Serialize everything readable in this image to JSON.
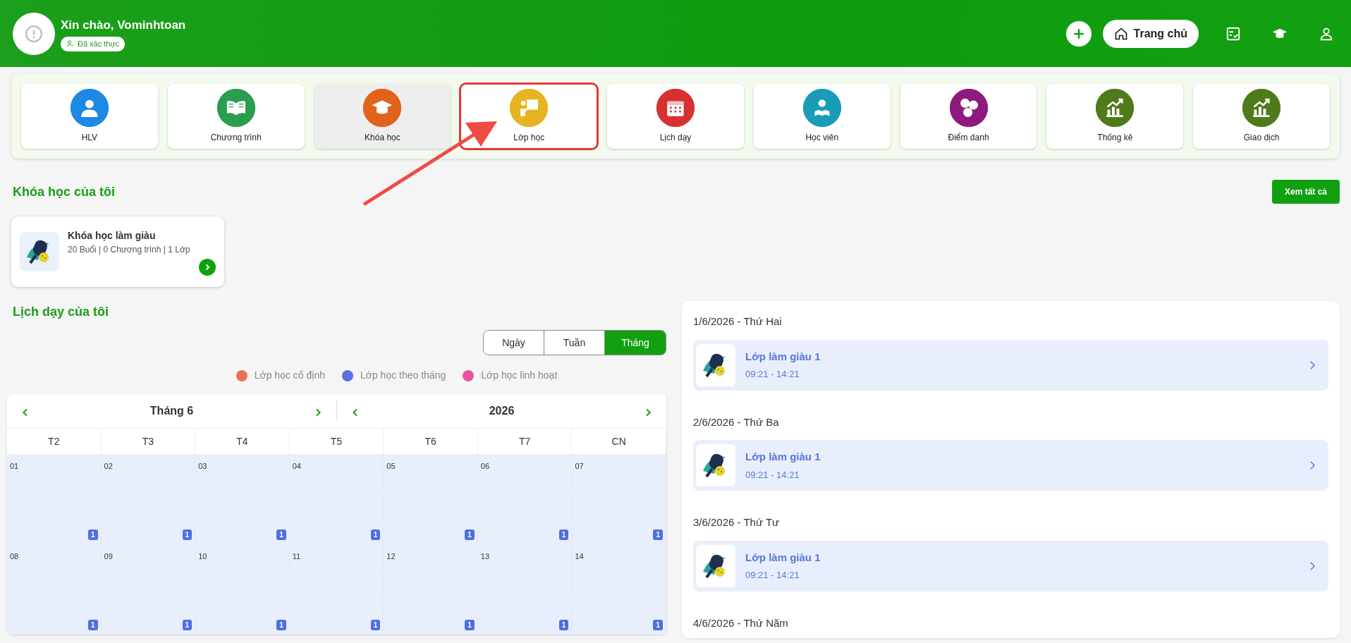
{
  "header": {
    "greeting": "Xin chào, Vominhtoan",
    "verified_badge": "Đã xác thực",
    "home_button": "Trang chủ"
  },
  "tiles": [
    {
      "label": "HLV",
      "kind": "person",
      "color": "#1e88e5",
      "selected": false,
      "highlighted": false
    },
    {
      "label": "Chương trình",
      "kind": "book",
      "color": "#2a9d4e",
      "selected": false,
      "highlighted": false
    },
    {
      "label": "Khóa học",
      "kind": "cap",
      "color": "#e0621b",
      "selected": true,
      "highlighted": false
    },
    {
      "label": "Lớp học",
      "kind": "teacher",
      "color": "#e6b422",
      "selected": false,
      "highlighted": true
    },
    {
      "label": "Lịch dạy",
      "kind": "calendar",
      "color": "#d63031",
      "selected": false,
      "highlighted": false
    },
    {
      "label": "Học viên",
      "kind": "reader",
      "color": "#1a9bb8",
      "selected": false,
      "highlighted": false
    },
    {
      "label": "Điểm danh",
      "kind": "numbers",
      "color": "#8e1a7e",
      "selected": false,
      "highlighted": false
    },
    {
      "label": "Thống kê",
      "kind": "chart",
      "color": "#4f7a1a",
      "selected": false,
      "highlighted": false
    },
    {
      "label": "Giao dịch",
      "kind": "chart",
      "color": "#4f7a1a",
      "selected": false,
      "highlighted": false
    }
  ],
  "my_courses": {
    "title": "Khóa học của tôi",
    "view_all": "Xem tất cả",
    "courses": [
      {
        "name": "Khóa học làm giàu",
        "meta": "20 Buổi | 0 Chương trình | 1 Lớp"
      }
    ]
  },
  "schedule": {
    "title": "Lịch dạy của tôi",
    "views": [
      {
        "label": "Ngày",
        "selected": false
      },
      {
        "label": "Tuần",
        "selected": false
      },
      {
        "label": "Tháng",
        "selected": true
      }
    ],
    "legend": [
      {
        "label": "Lớp học cố định",
        "color": "#e8705a"
      },
      {
        "label": "Lớp học theo tháng",
        "color": "#5a6fe0"
      },
      {
        "label": "Lớp học linh hoạt",
        "color": "#e8559e"
      }
    ],
    "month": "Tháng 6",
    "year": "2026",
    "weekdays": [
      "T2",
      "T3",
      "T4",
      "T5",
      "T6",
      "T7",
      "CN"
    ],
    "days": [
      {
        "day": "01",
        "count": "1"
      },
      {
        "day": "02",
        "count": "1"
      },
      {
        "day": "03",
        "count": "1"
      },
      {
        "day": "04",
        "count": "1"
      },
      {
        "day": "05",
        "count": "1"
      },
      {
        "day": "06",
        "count": "1"
      },
      {
        "day": "07",
        "count": "1"
      },
      {
        "day": "08",
        "count": "1"
      },
      {
        "day": "09",
        "count": "1"
      },
      {
        "day": "10",
        "count": "1"
      },
      {
        "day": "11",
        "count": "1"
      },
      {
        "day": "12",
        "count": "1"
      },
      {
        "day": "13",
        "count": "1"
      },
      {
        "day": "14",
        "count": "1"
      }
    ]
  },
  "agenda": [
    {
      "date": "1/6/2026 - Thứ Hai",
      "items": [
        {
          "title": "Lớp làm giàu 1",
          "time": "09:21 - 14:21"
        }
      ]
    },
    {
      "date": "2/6/2026 - Thứ Ba",
      "items": [
        {
          "title": "Lớp làm giàu 1",
          "time": "09:21 - 14:21"
        }
      ]
    },
    {
      "date": "3/6/2026 - Thứ Tư",
      "items": [
        {
          "title": "Lớp làm giàu 1",
          "time": "09:21 - 14:21"
        }
      ]
    },
    {
      "date": "4/6/2026 - Thứ Năm"
    }
  ]
}
